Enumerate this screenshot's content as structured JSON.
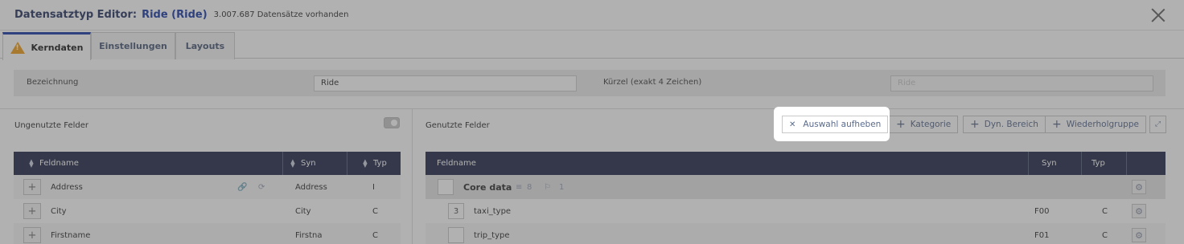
{
  "header": {
    "title": "Datensatztyp Editor:",
    "record_name": "Ride (Ride)",
    "record_count": "3.007.687 Datensätze vorhanden"
  },
  "tabs": [
    {
      "label": "Kerndaten",
      "icon": "warning-icon",
      "active": true
    },
    {
      "label": "Einstellungen",
      "active": false
    },
    {
      "label": "Layouts",
      "active": false
    }
  ],
  "form": {
    "name_label": "Bezeichnung",
    "name_value": "Ride",
    "short_label": "Kürzel (exakt 4 Zeichen)",
    "short_value": "Ride"
  },
  "left_panel": {
    "title": "Ungenutzte Felder",
    "columns": [
      "Feldname",
      "Syn",
      "Typ"
    ],
    "rows": [
      {
        "name": "Address",
        "syn": "Address",
        "typ": "I"
      },
      {
        "name": "City",
        "syn": "City",
        "typ": "C"
      },
      {
        "name": "Firstname",
        "syn": "Firstna",
        "typ": "C"
      }
    ]
  },
  "right_panel": {
    "title": "Genutzte Felder",
    "deselect_label": "Auswahl aufheben",
    "buttons": [
      "Kategorie",
      "Dyn. Bereich",
      "Wiederholgruppe"
    ],
    "columns": [
      "Feldname",
      "Syn",
      "Typ"
    ],
    "group": {
      "name": "Core data",
      "field_count": "8",
      "rule_count": "1"
    },
    "rows": [
      {
        "badge": "3",
        "name": "taxi_type",
        "syn": "F00",
        "typ": "C"
      },
      {
        "badge": "",
        "name": "trip_type",
        "syn": "F01",
        "typ": "C"
      }
    ]
  },
  "colors": {
    "accent": "#1f3fa8",
    "table_header": "#28304f",
    "warning": "#f0a020"
  }
}
